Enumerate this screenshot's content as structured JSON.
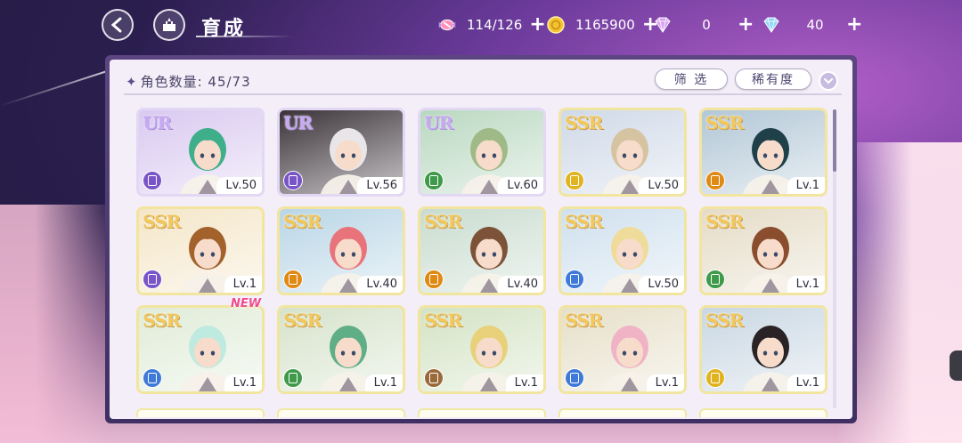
{
  "header": {
    "title": "育成",
    "resources": [
      {
        "name": "stamina",
        "icon": "candy-icon",
        "value": "114/126"
      },
      {
        "name": "coins",
        "icon": "coin-icon",
        "value": "1165900"
      },
      {
        "name": "pink-gems",
        "icon": "pink-gem-icon",
        "value": "0"
      },
      {
        "name": "blue-gems",
        "icon": "blue-gem-icon",
        "value": "40"
      }
    ],
    "plus": "+"
  },
  "panel": {
    "count_label": "角色数量: 45/73",
    "filter_label": "筛 选",
    "rarity_label": "稀有度"
  },
  "colors": {
    "panel_bg": "#f3eef7",
    "frame": "#4c3a70",
    "attr_purple": "#7a55c8",
    "attr_green": "#3f9a4a",
    "attr_yellow": "#e2b320",
    "attr_orange": "#e08a16",
    "attr_blue": "#3f7ad8",
    "attr_brown": "#9a6a3a"
  },
  "characters": [
    {
      "rarity": "UR",
      "attr": "purple",
      "level": "Lv.50",
      "hair": "#3fae8a",
      "bg": "#d9c9f0",
      "new": false
    },
    {
      "rarity": "UR",
      "attr": "purple",
      "level": "Lv.56",
      "hair": "#e9e6ea",
      "bg": "#3a3238",
      "new": false
    },
    {
      "rarity": "UR",
      "attr": "green",
      "level": "Lv.60",
      "hair": "#9fba86",
      "bg": "#b9d8c0",
      "new": false
    },
    {
      "rarity": "SSR",
      "attr": "yellow",
      "level": "Lv.50",
      "hair": "#d6c3a2",
      "bg": "#cfd9e8",
      "new": false
    },
    {
      "rarity": "SSR",
      "attr": "orange",
      "level": "Lv.1",
      "hair": "#1f4048",
      "bg": "#b2c7d6",
      "new": false
    },
    {
      "rarity": "SSR",
      "attr": "purple",
      "level": "Lv.1",
      "hair": "#a3612c",
      "bg": "#f4e6c8",
      "new": false
    },
    {
      "rarity": "SSR",
      "attr": "orange",
      "level": "Lv.40",
      "hair": "#e9737a",
      "bg": "#b9d6e6",
      "new": false
    },
    {
      "rarity": "SSR",
      "attr": "orange",
      "level": "Lv.40",
      "hair": "#7c5238",
      "bg": "#c9dccf",
      "new": false
    },
    {
      "rarity": "SSR",
      "attr": "blue",
      "level": "Lv.50",
      "hair": "#f0dc9a",
      "bg": "#cfe0ee",
      "new": false
    },
    {
      "rarity": "SSR",
      "attr": "green",
      "level": "Lv.1",
      "hair": "#8a4d2d",
      "bg": "#e5dcc7",
      "new": false
    },
    {
      "rarity": "SSR",
      "attr": "blue",
      "level": "Lv.1",
      "hair": "#bfeadf",
      "bg": "#e0ecd8",
      "new": true
    },
    {
      "rarity": "SSR",
      "attr": "green",
      "level": "Lv.1",
      "hair": "#5fae86",
      "bg": "#d6e3cb",
      "new": false
    },
    {
      "rarity": "SSR",
      "attr": "brown",
      "level": "Lv.1",
      "hair": "#e8d17a",
      "bg": "#d3e3c4",
      "new": false
    },
    {
      "rarity": "SSR",
      "attr": "blue",
      "level": "Lv.1",
      "hair": "#f0b3c6",
      "bg": "#e6dfc8",
      "new": false
    },
    {
      "rarity": "SSR",
      "attr": "yellow",
      "level": "Lv.1",
      "hair": "#2a2326",
      "bg": "#c9d7e3",
      "new": false
    }
  ],
  "new_badge": "NEW"
}
